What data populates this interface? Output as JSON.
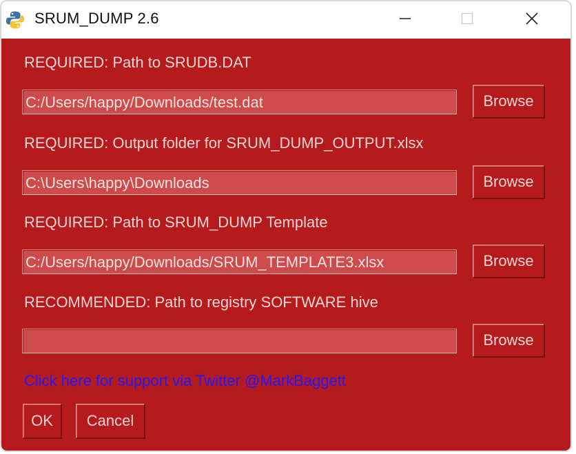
{
  "window": {
    "title": "SRUM_DUMP 2.6",
    "icon": "python-icon",
    "controls": {
      "minimize": "minimize-icon",
      "maximize": "maximize-icon",
      "close": "close-icon"
    }
  },
  "fields": [
    {
      "label": "REQUIRED: Path to SRUDB.DAT",
      "value": "C:/Users/happy/Downloads/test.dat",
      "button": "Browse"
    },
    {
      "label": "REQUIRED: Output folder for SRUM_DUMP_OUTPUT.xlsx",
      "value": "C:\\Users\\happy\\Downloads",
      "button": "Browse"
    },
    {
      "label": "REQUIRED: Path to SRUM_DUMP Template",
      "value": "C:/Users/happy/Downloads/SRUM_TEMPLATE3.xlsx",
      "button": "Browse"
    },
    {
      "label": "RECOMMENDED: Path to registry SOFTWARE hive",
      "value": "",
      "button": "Browse"
    }
  ],
  "support_link": "Click here for support via Twitter @MarkBaggett",
  "actions": {
    "ok": "OK",
    "cancel": "Cancel"
  },
  "colors": {
    "background": "#b51a1d",
    "input": "#cd4b4a",
    "text": "#f6d6d4",
    "link": "#3417d6"
  }
}
